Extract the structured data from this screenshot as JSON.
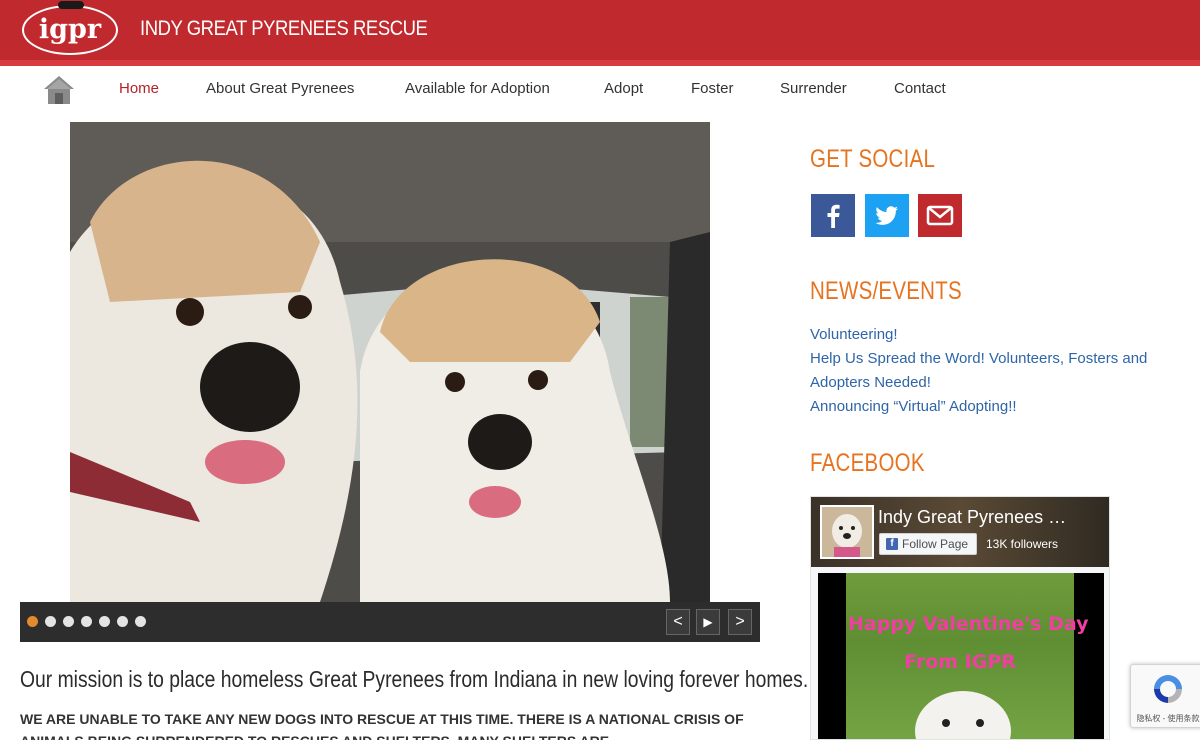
{
  "header": {
    "logo_text": "igpr",
    "site_title": "INDY GREAT PYRENEES RESCUE",
    "brand_color": "#c0292e"
  },
  "nav": {
    "home_icon": "home-icon",
    "items": [
      {
        "label": "Home",
        "active": true
      },
      {
        "label": "About Great Pyrenees",
        "active": false
      },
      {
        "label": "Available for Adoption",
        "active": false
      },
      {
        "label": "Adopt",
        "active": false
      },
      {
        "label": "Foster",
        "active": false
      },
      {
        "label": "Surrender",
        "active": false
      },
      {
        "label": "Contact",
        "active": false
      }
    ]
  },
  "slider": {
    "slide_count": 7,
    "active_index": 0,
    "prev_label": "<",
    "play_label": "▶",
    "next_label": ">"
  },
  "main": {
    "mission": "Our mission is to place homeless Great Pyrenees from Indiana in new loving forever homes.",
    "notice": "WE ARE UNABLE TO TAKE ANY NEW DOGS INTO RESCUE AT THIS TIME.  THERE IS A NATIONAL CRISIS OF ANIMALS BEING SURRENDERED TO RESCUES AND SHELTERS.  MANY SHELTERS ARE"
  },
  "sidebar": {
    "social_heading": "GET SOCIAL",
    "social": [
      {
        "icon": "facebook-icon",
        "color": "#3b5998"
      },
      {
        "icon": "twitter-icon",
        "color": "#1da1f2"
      },
      {
        "icon": "email-icon",
        "color": "#c0292e"
      }
    ],
    "news_heading": "NEWS/EVENTS",
    "news": [
      "Volunteering!",
      "Help Us Spread the Word! Volunteers, Fosters and",
      "Adopters Needed!",
      "Announcing “Virtual” Adopting!!"
    ],
    "facebook_heading": "FACEBOOK",
    "accent_color": "#e6731f",
    "link_color": "#2e65a8"
  },
  "facebook_widget": {
    "page_name": "Indy Great Pyrenees …",
    "follow_label": "Follow Page",
    "followers": "13K followers",
    "video_line1": "Happy Valentine's Day",
    "video_line2": "From IGPR"
  },
  "recaptcha": {
    "footer": "隐私权 - 使用条款"
  }
}
